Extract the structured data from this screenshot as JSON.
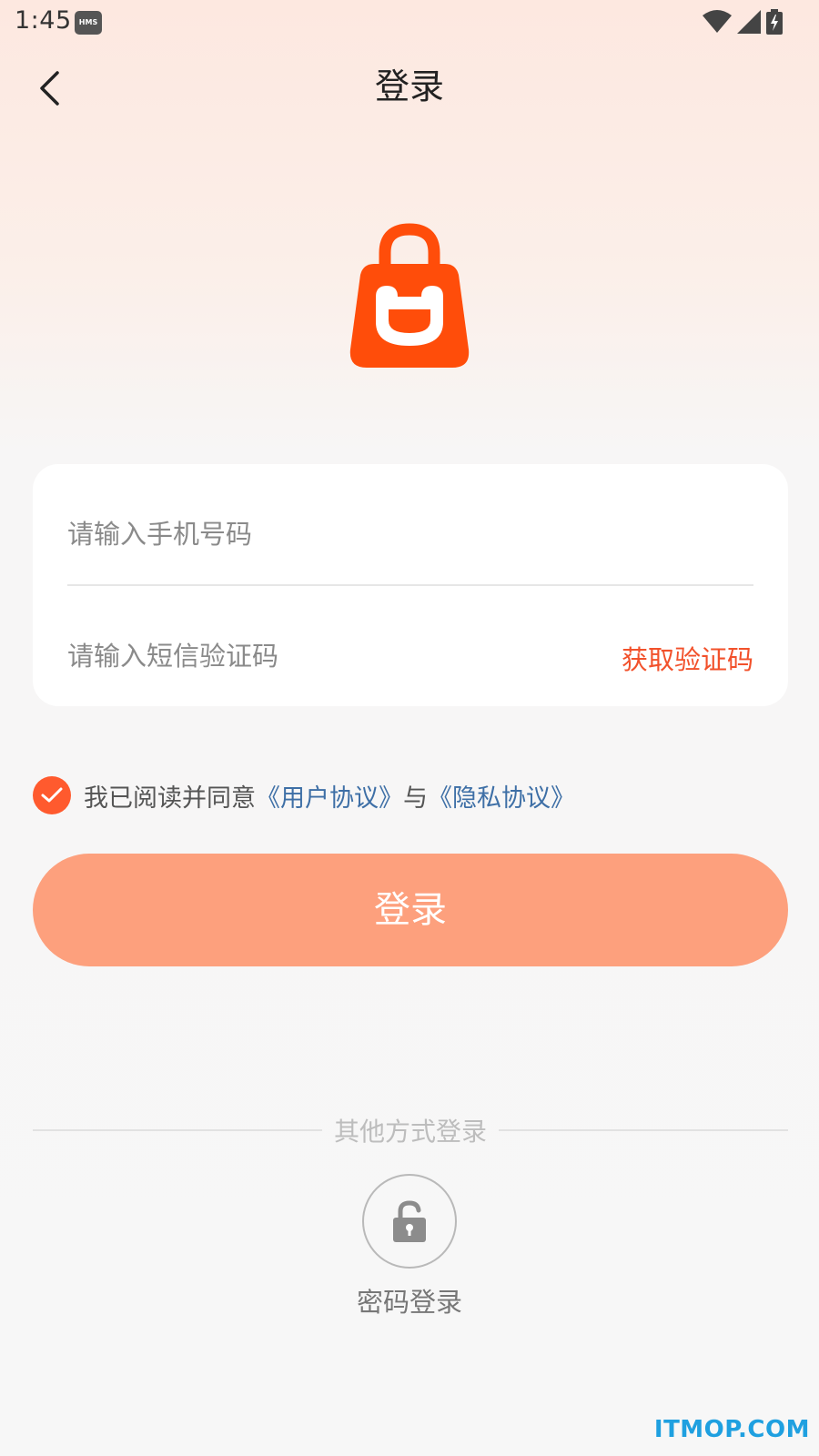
{
  "status_bar": {
    "time": "1:45",
    "badge": "HMS"
  },
  "nav": {
    "title": "登录"
  },
  "form": {
    "phone_placeholder": "请输入手机号码",
    "code_placeholder": "请输入短信验证码",
    "get_code_label": "获取验证码"
  },
  "agreement": {
    "text": "我已阅读并同意",
    "user_agreement": "《用户协议》",
    "and": "与",
    "privacy_agreement": "《隐私协议》",
    "checked": true
  },
  "login_button": {
    "label": "登录"
  },
  "other_login": {
    "divider_text": "其他方式登录",
    "password_login_label": "密码登录"
  },
  "watermark": "ITMOP.COM",
  "colors": {
    "accent": "#ff5a2e",
    "button": "#fda07d",
    "link": "#3e6fa6"
  }
}
